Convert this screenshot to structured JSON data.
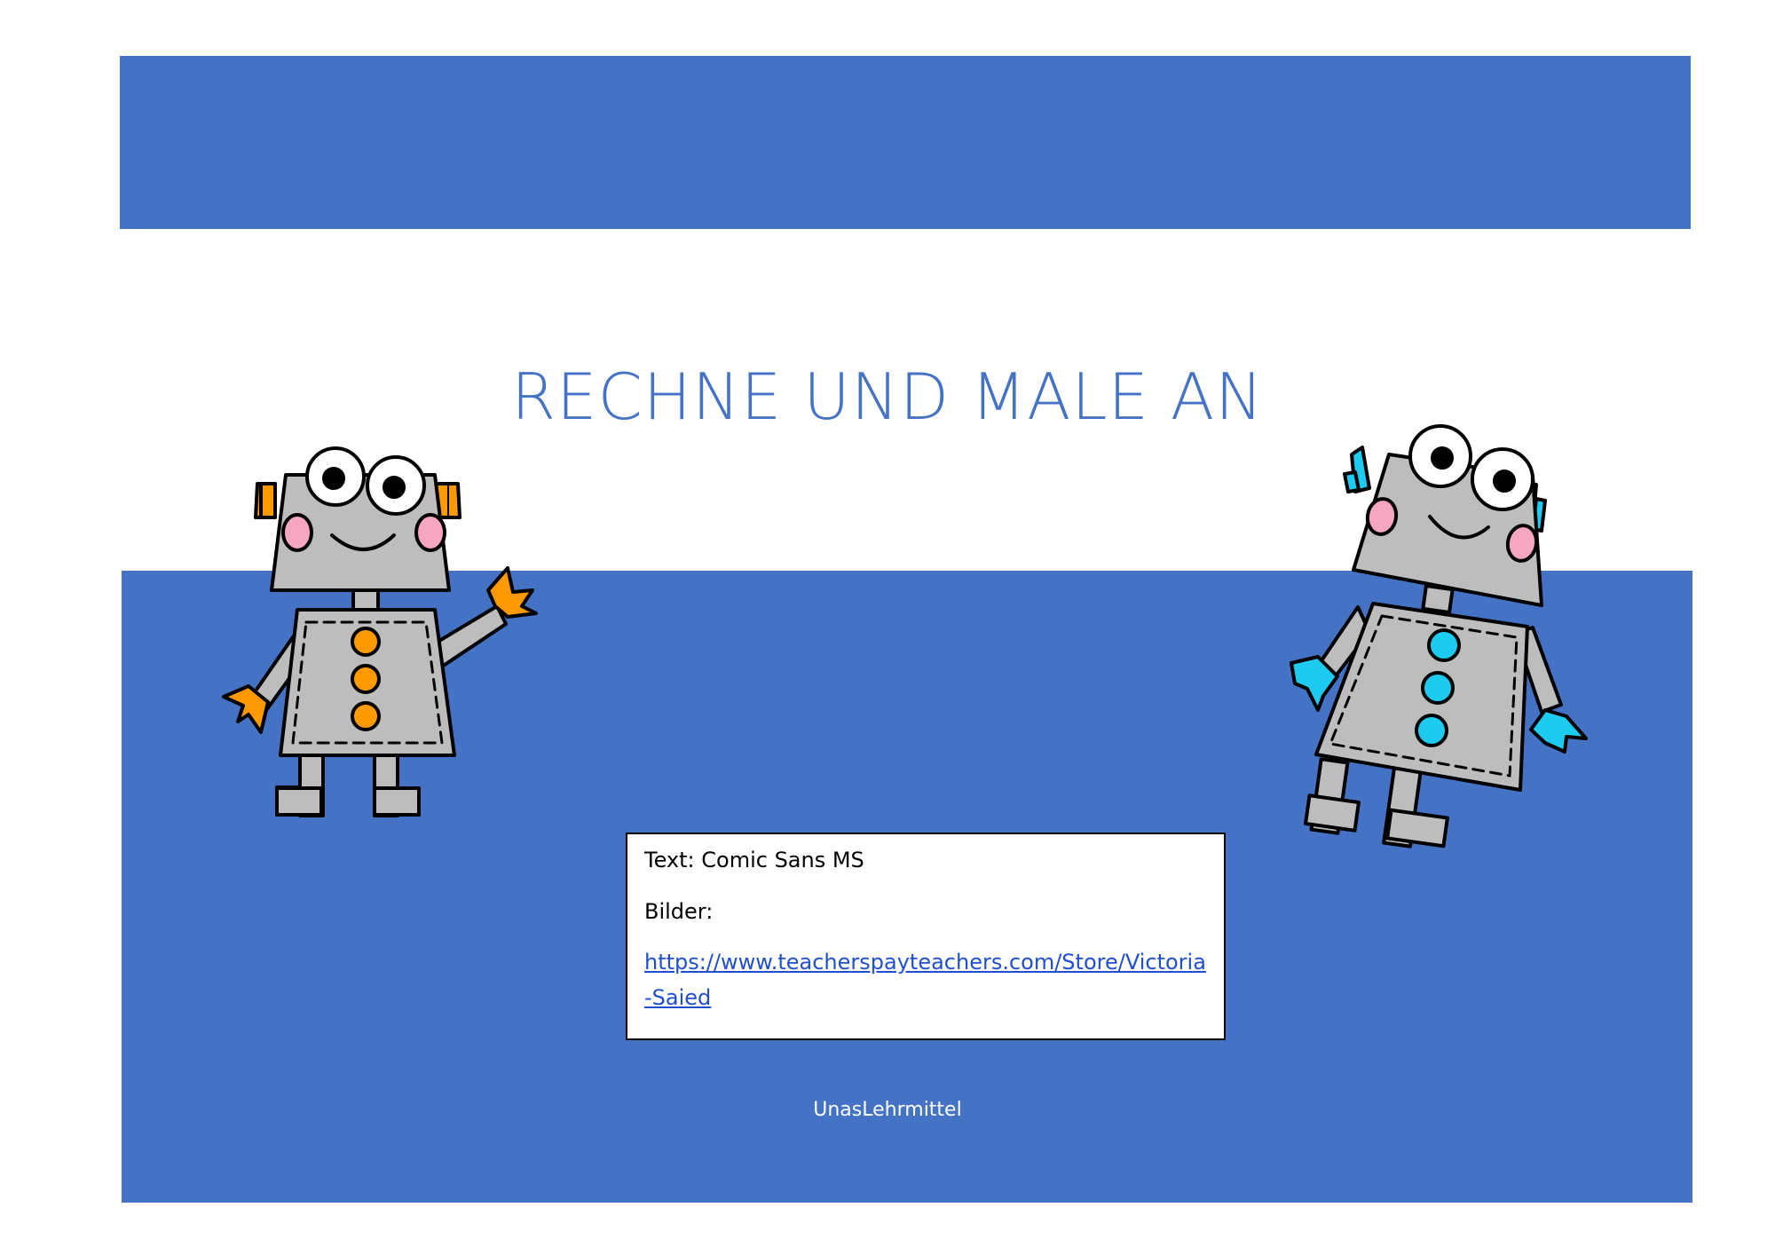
{
  "title": "RECHNE UND MALE AN",
  "credits": {
    "text_line": "Text: Comic Sans MS",
    "images_label": "Bilder:",
    "images_link": "https://www.teacherspayteachers.com/Store/Victoria-Saied"
  },
  "author": "UnasLehrmittel",
  "colors": {
    "band": "#4472c4",
    "robot_left_accent": "#ff9900",
    "robot_right_accent": "#1ecbf0",
    "robot_body": "#bdbdbd",
    "cheek": "#f6a6c0"
  },
  "icons": {
    "left": "robot-orange-waving-icon",
    "right": "robot-cyan-icon"
  }
}
